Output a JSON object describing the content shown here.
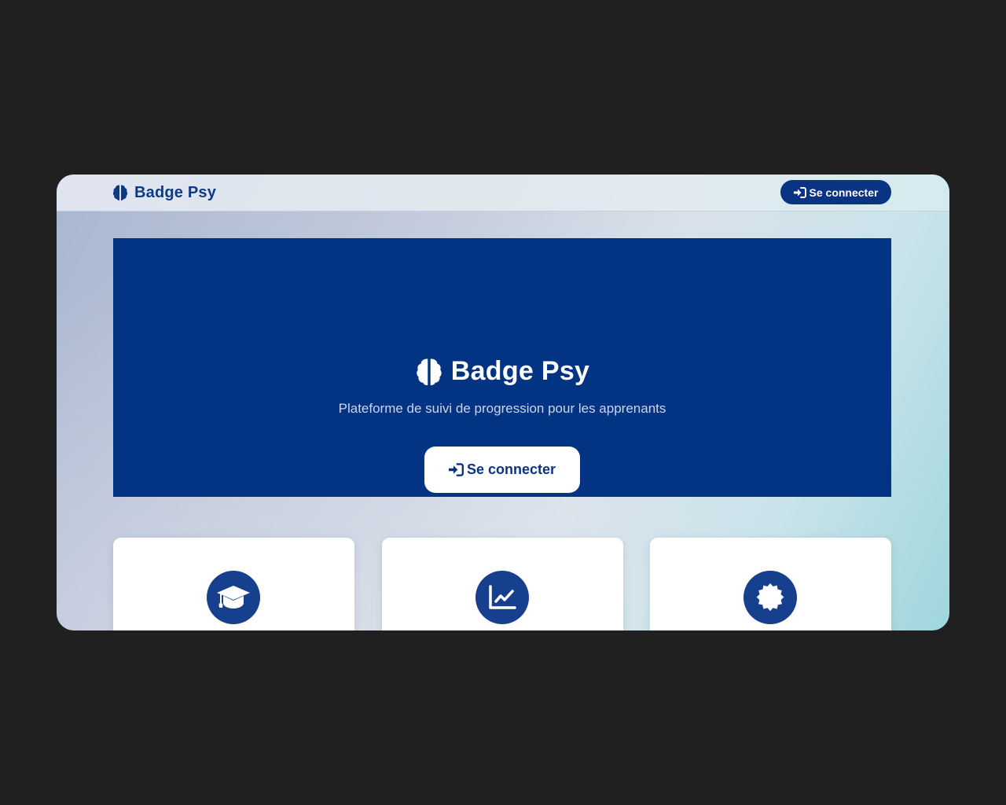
{
  "navbar": {
    "brand": "Badge Psy",
    "login_label": "Se connecter"
  },
  "hero": {
    "title": "Badge Psy",
    "subtitle": "Plateforme de suivi de progression pour les apprenants",
    "login_label": "Se connecter"
  },
  "features": [
    {
      "icon": "graduation-cap-icon"
    },
    {
      "icon": "chart-line-icon"
    },
    {
      "icon": "certificate-icon"
    }
  ],
  "colors": {
    "primary": "#033383",
    "button_dark": "#0a3384",
    "icon_circle": "#163f8d",
    "page_background": "#202020"
  }
}
